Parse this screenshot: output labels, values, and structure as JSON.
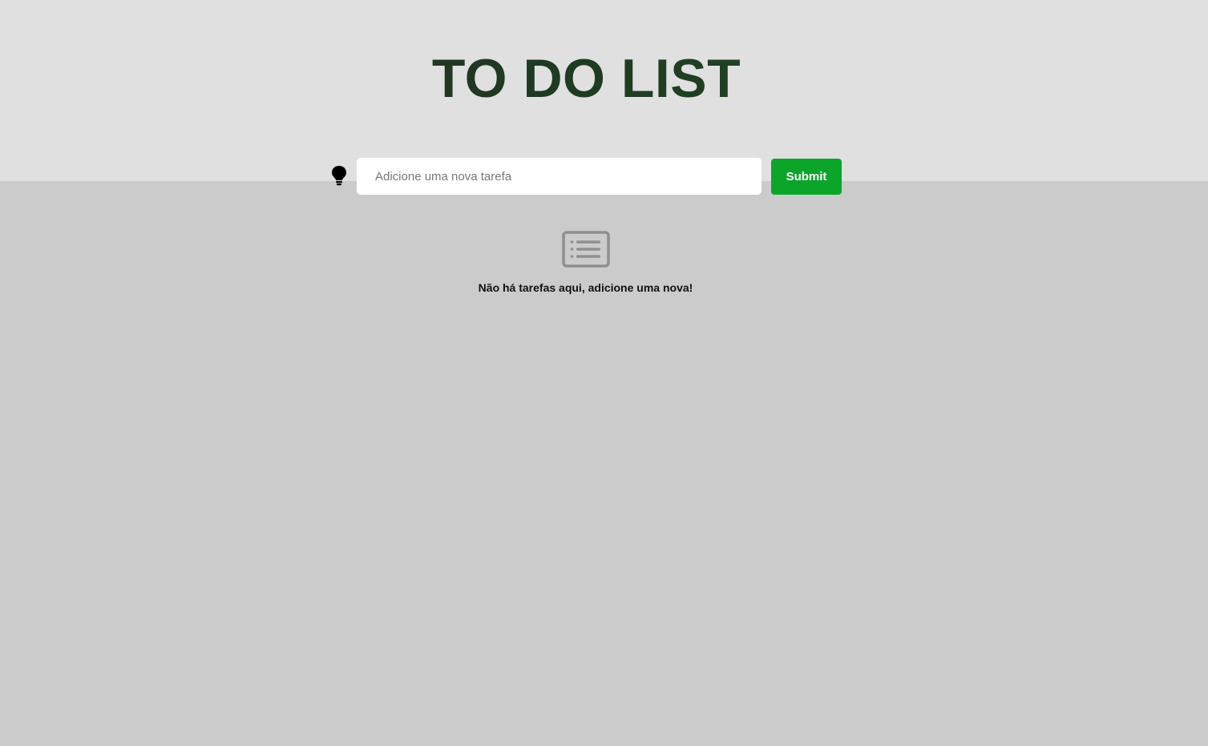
{
  "app": {
    "title": "TO DO LIST"
  },
  "form": {
    "placeholder": "Adicione uma nova tarefa",
    "value": "",
    "submit_label": "Submit"
  },
  "icons": {
    "theme_toggle": "lightbulb-icon",
    "empty_list": "list-icon"
  },
  "empty_state": {
    "message": "Não há tarefas aqui, adicione uma nova!"
  },
  "colors": {
    "accent": "#0ba52a",
    "header_bg": "#e0e0e0",
    "page_bg": "#cbcbcb",
    "title_start": "#252b25",
    "title_end": "#1e4d24"
  }
}
